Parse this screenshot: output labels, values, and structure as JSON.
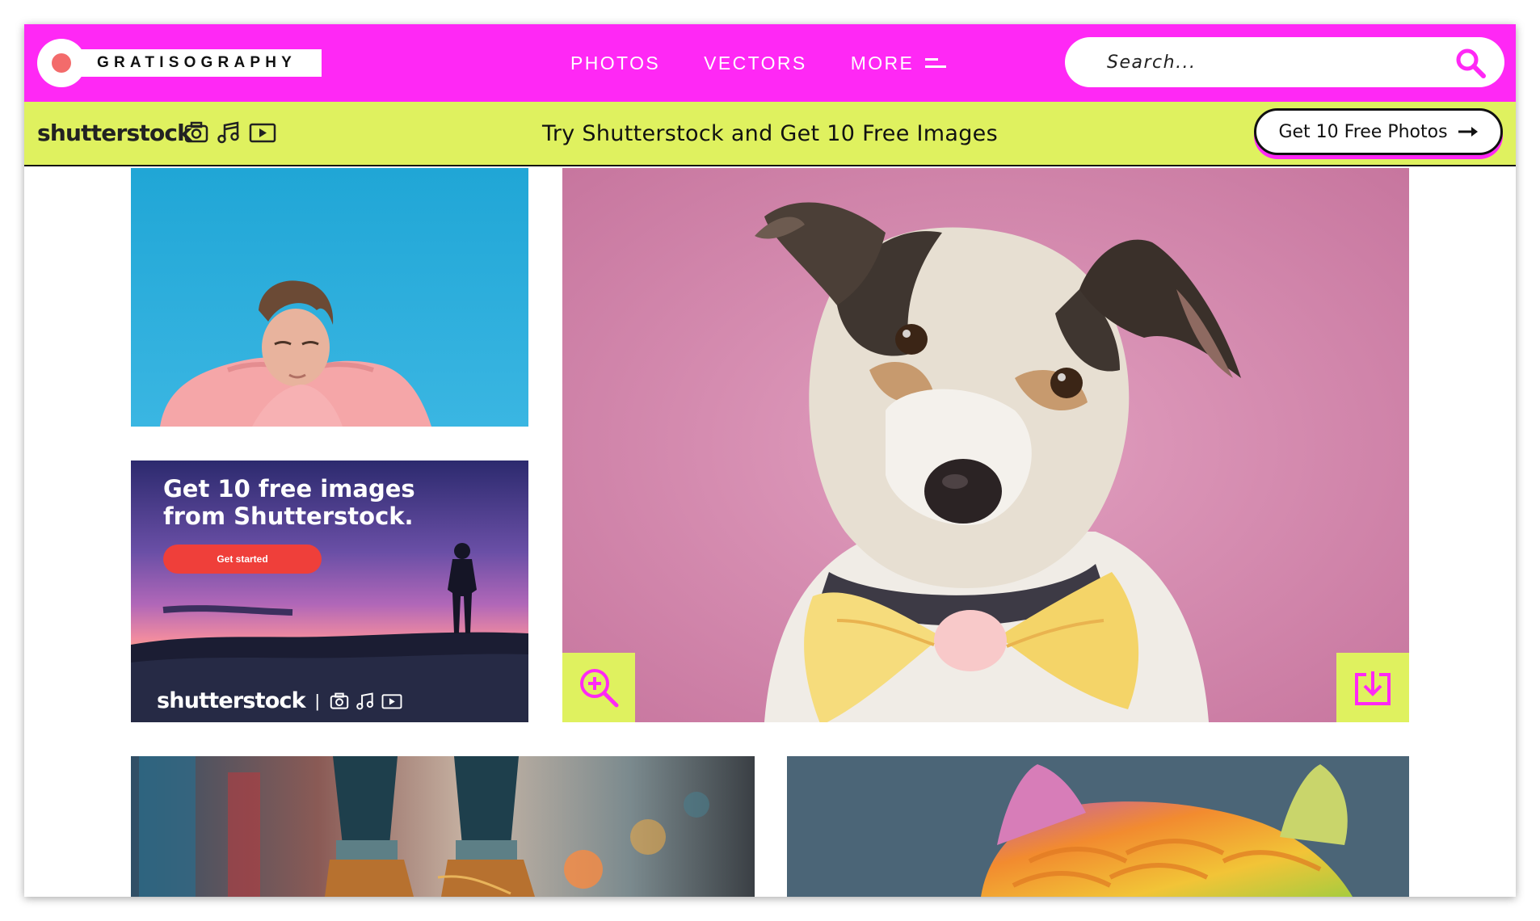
{
  "brand": {
    "name": "GRATISOGRAPHY"
  },
  "nav": {
    "items": [
      {
        "label": "PHOTOS"
      },
      {
        "label": "VECTORS"
      },
      {
        "label": "MORE"
      }
    ]
  },
  "search": {
    "placeholder": "Search..."
  },
  "promo": {
    "brand": "shutterstock",
    "headline": "Try Shutterstock and Get 10 Free Images",
    "button_label": "Get 10 Free Photos"
  },
  "ad": {
    "title": "Get 10 free images from Shutterstock.",
    "button_label": "Get started",
    "brand": "shutterstock",
    "separator": "|"
  },
  "colors": {
    "header": "#ff28f5",
    "promo_bar": "#dff15f",
    "ad_button": "#ef3f3a"
  },
  "icons": {
    "search": "search-icon",
    "menu": "menu-icon",
    "zoom": "zoom-in-icon",
    "download": "download-icon",
    "camera": "camera-icon",
    "music": "music-note-icon",
    "video": "video-play-icon",
    "arrow": "arrow-right-icon"
  }
}
